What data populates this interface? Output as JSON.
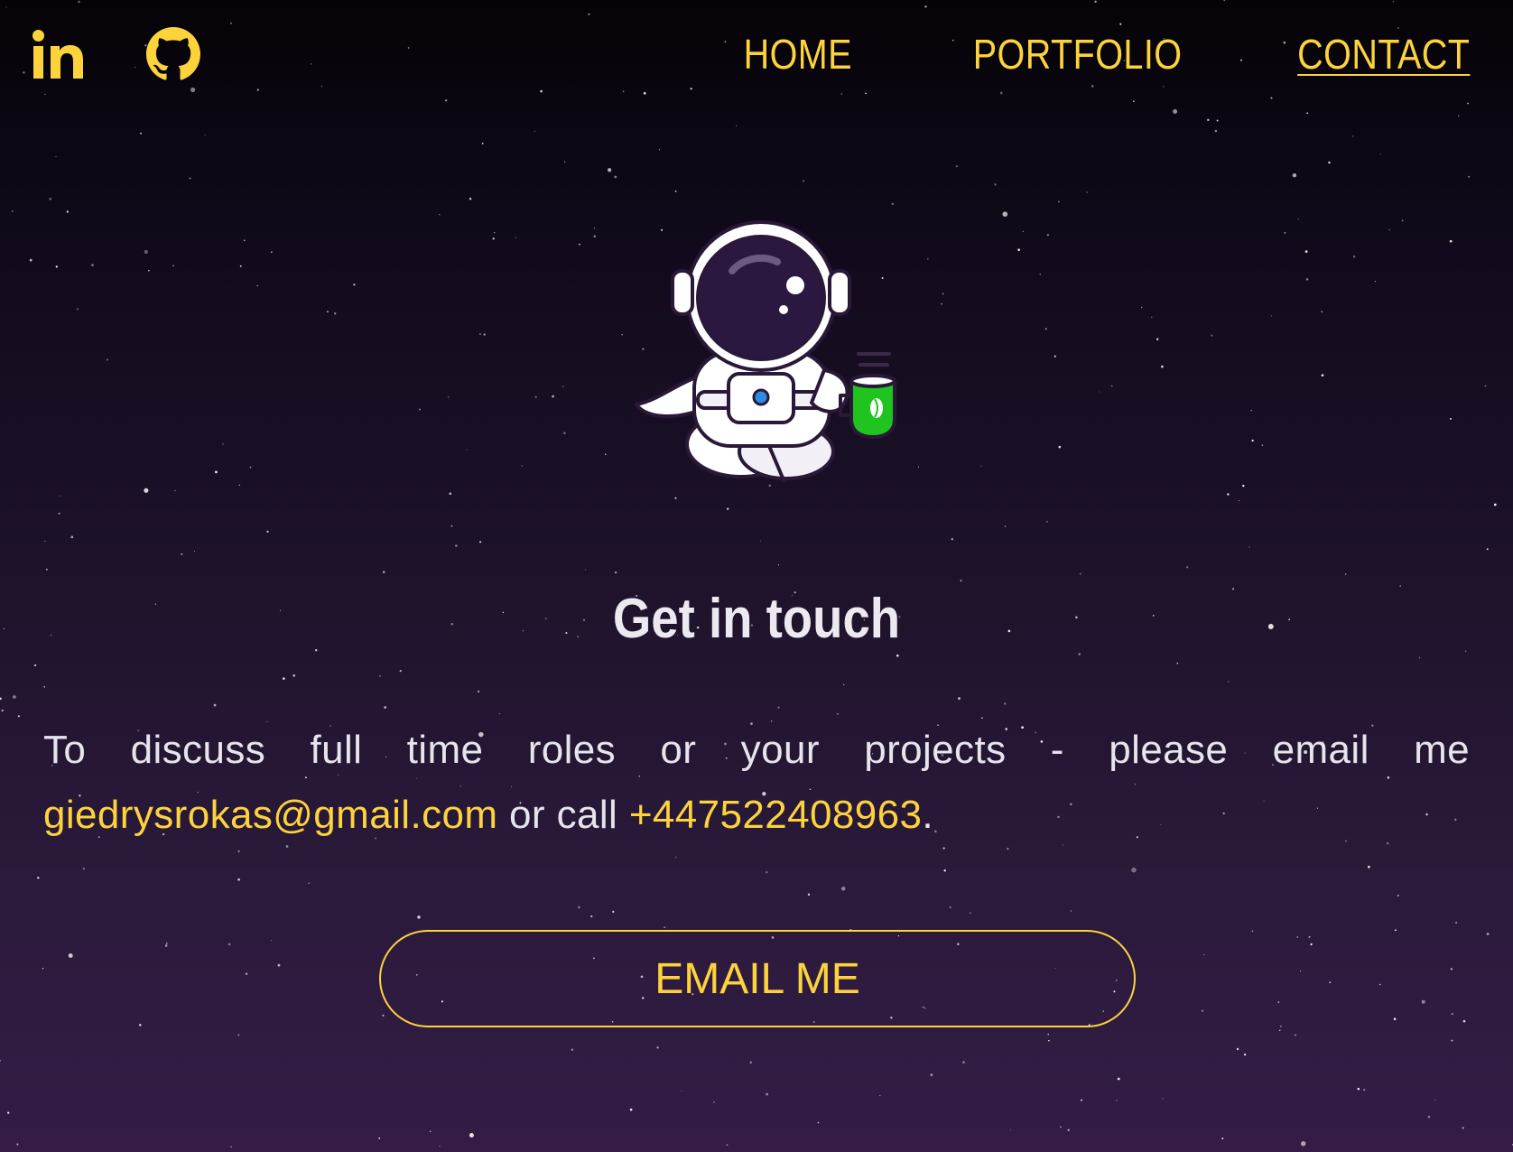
{
  "header": {
    "social": [
      {
        "icon": "linkedin-icon",
        "label": "in"
      },
      {
        "icon": "github-icon"
      }
    ],
    "nav": [
      {
        "label": "HOME",
        "active": false
      },
      {
        "label": "PORTFOLIO",
        "active": false
      },
      {
        "label": "CONTACT",
        "active": true
      }
    ]
  },
  "main": {
    "illustration": "astronaut-with-coffee-icon",
    "title": "Get in touch",
    "intro": "To discuss full time roles or your projects - please email me",
    "email": "giedrysrokas@gmail.com",
    "connector": " or call ",
    "phone": "+447522408963",
    "end": ".",
    "button_label": "EMAIL ME"
  },
  "colors": {
    "accent": "#fdd33c",
    "text": "#e8e6ee",
    "background_top": "#050307",
    "background_bottom": "#341c45"
  }
}
